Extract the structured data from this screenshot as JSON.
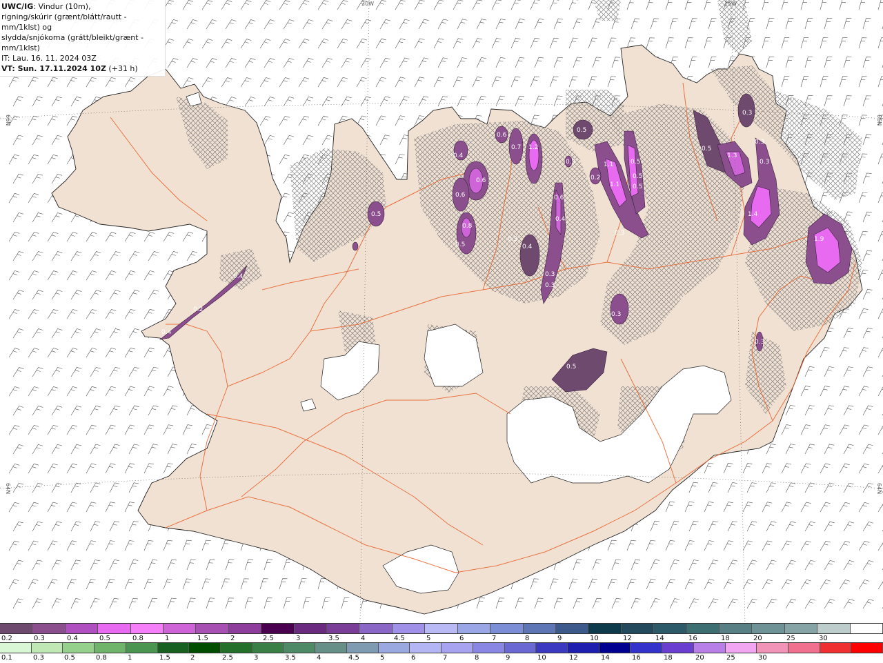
{
  "info": {
    "model": "UWC/IG",
    "line1": ": Vindur (10m),",
    "line2": "rigning/skúrir (grænt/blátt/rautt - mm/1klst) og",
    "line3": "slydda/snjókoma (grátt/bleikt/grænt - mm/1klst)",
    "it": "IT: Lau. 16. 11. 2024 03Z",
    "vt_label": "VT: Sun. 17.11.2024 10Z",
    "vt_offset": " (+31 h)"
  },
  "graticule": {
    "lon_top_left": "20W",
    "lon_top_right": "15W",
    "lat_left_top": "66N",
    "lat_right_top": "66N",
    "lat_left_bottom": "64N",
    "lat_right_bottom": "64N"
  },
  "precip_labels": [
    "0.5",
    "0.4",
    "0.4",
    "0.2",
    "0.4",
    "0.6",
    "0.6",
    "0.8",
    "0.5",
    "0.6",
    "0.7",
    "1.2",
    "0.5",
    "0.3",
    "0.2",
    "1.1",
    "1.1",
    "0.5",
    "0.5",
    "0.5",
    "0.3",
    "0.6",
    "0.4",
    "0.4",
    "0.3",
    "0.3",
    "0.3",
    "0.5",
    "1.3",
    "0.3",
    "1.4",
    "0.3",
    "1.9",
    "0.3",
    "0.5",
    "0.3",
    "0.3"
  ],
  "legend_snow": {
    "colors": [
      "#6e4a6e",
      "#8a4f8c",
      "#b04fbf",
      "#e86af0",
      "#f57ff8",
      "#cf64d9",
      "#a84fb4",
      "#8f3d9c",
      "#4a004f",
      "#6a2a80",
      "#7a3e98",
      "#8a66c6",
      "#a090e8",
      "#b9b9f5",
      "#9aa6e6",
      "#7c8fd6",
      "#5f76b6",
      "#3e5a8c",
      "#0e3b4c",
      "#234a5c",
      "#2d5a68",
      "#3d6e72",
      "#577f84",
      "#6e9296",
      "#86a4a6",
      "#bccdcb",
      "#ffffff"
    ],
    "ticks": [
      "0.2",
      "0.3",
      "0.4",
      "0.5",
      "0.8",
      "1",
      "1.5",
      "2",
      "2.5",
      "3",
      "3.5",
      "4",
      "4.5",
      "5",
      "6",
      "7",
      "8",
      "9",
      "10",
      "12",
      "14",
      "16",
      "18",
      "20",
      "25",
      "30"
    ]
  },
  "legend_rain": {
    "colors": [
      "#d9f7d4",
      "#bfe8b5",
      "#96d08d",
      "#6fb46a",
      "#4a9650",
      "#18601f",
      "#004d00",
      "#24702a",
      "#3a7f45",
      "#4f8a66",
      "#668f88",
      "#7f9bb2",
      "#9aa9e0",
      "#b3b6f2",
      "#a7a3f0",
      "#8a86e3",
      "#6a68d2",
      "#3a39c0",
      "#1e1eaf",
      "#000090",
      "#3333cc",
      "#6a3fd0",
      "#b97fe8",
      "#f2a6f2",
      "#f294b8",
      "#f07090",
      "#f03030",
      "#ff0000"
    ],
    "ticks": [
      "0.1",
      "0.3",
      "0.5",
      "0.8",
      "1",
      "1.5",
      "2",
      "2.5",
      "3",
      "3.5",
      "4",
      "4.5",
      "5",
      "6",
      "7",
      "8",
      "9",
      "10",
      "12",
      "14",
      "16",
      "18",
      "20",
      "25",
      "30"
    ]
  }
}
